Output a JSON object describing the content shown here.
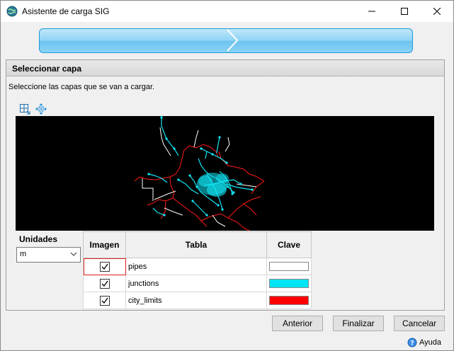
{
  "window": {
    "title": "Asistente de carga SIG"
  },
  "panel": {
    "title": "Seleccionar capa",
    "instruction": "Seleccione las capas que se van a cargar."
  },
  "units": {
    "label": "Unidades",
    "selected": "m"
  },
  "table": {
    "headers": [
      "Imagen",
      "Tabla",
      "Clave"
    ],
    "rows": [
      {
        "checked": true,
        "name": "pipes",
        "color": "#ffffff"
      },
      {
        "checked": true,
        "name": "junctions",
        "color": "#00e5f5"
      },
      {
        "checked": true,
        "name": "city_limits",
        "color": "#ff0000"
      }
    ]
  },
  "buttons": {
    "back": "Anterior",
    "finish": "Finalizar",
    "cancel": "Cancelar"
  },
  "help": {
    "label": "Ayuda"
  },
  "icons": [
    "app-globe-icon",
    "minimize-icon",
    "maximize-icon",
    "close-icon",
    "zoom-extent-icon",
    "pan-icon",
    "help-icon"
  ]
}
